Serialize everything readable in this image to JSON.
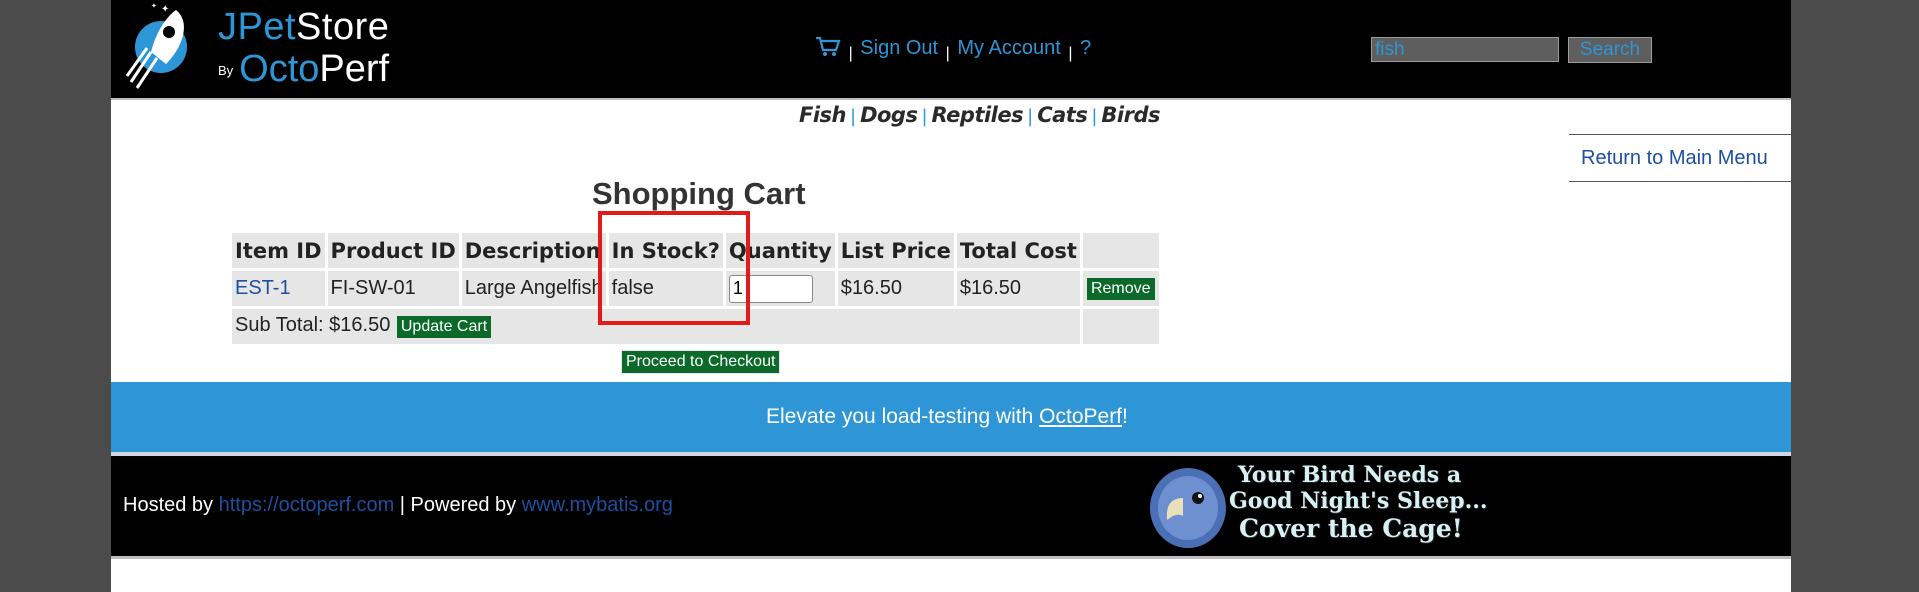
{
  "header": {
    "logo": {
      "line1_a": "J",
      "line1_b": "Pet",
      "line1_c": "Store",
      "by": "By",
      "line2_a": "Octo",
      "line2_b": "Perf"
    },
    "menu": {
      "cart_icon": "cart-icon",
      "sep1": "|",
      "sign_out": "Sign Out",
      "sep2": "|",
      "my_account": "My Account",
      "sep3": "|",
      "help": "?"
    },
    "search": {
      "value": "fish",
      "button": "Search"
    }
  },
  "quicklinks": [
    "Fish",
    "Dogs",
    "Reptiles",
    "Cats",
    "Birds"
  ],
  "return_link": "Return to Main Menu",
  "cart": {
    "title": "Shopping Cart",
    "columns": [
      "Item ID",
      "Product ID",
      "Description",
      "In Stock?",
      "Quantity",
      "List Price",
      "Total Cost"
    ],
    "rows": [
      {
        "item_id": "EST-1",
        "product_id": "FI-SW-01",
        "description": "Large Angelfish",
        "in_stock": "false",
        "quantity": "1",
        "list_price": "$16.50",
        "total_cost": "$16.50",
        "remove": "Remove"
      }
    ],
    "subtotal": "Sub Total: $16.50",
    "update_button": "Update Cart",
    "checkout_button": "Proceed to Checkout"
  },
  "banner": {
    "prefix": "Elevate you load-testing with ",
    "link": "OctoPerf",
    "suffix": "!"
  },
  "footer": {
    "hosted_prefix": "Hosted by ",
    "hosted_link": "https://octoperf.com",
    "powered_prefix": " | Powered by ",
    "powered_link": "www.mybatis.org",
    "ad": {
      "line1": "Your Bird Needs a",
      "line2": "Good Night's Sleep...",
      "line3": "Cover the Cage!"
    }
  },
  "colors": {
    "accent": "#2e96d6",
    "highlight": "#e21a1a",
    "button_green": "#0b6a2a"
  }
}
